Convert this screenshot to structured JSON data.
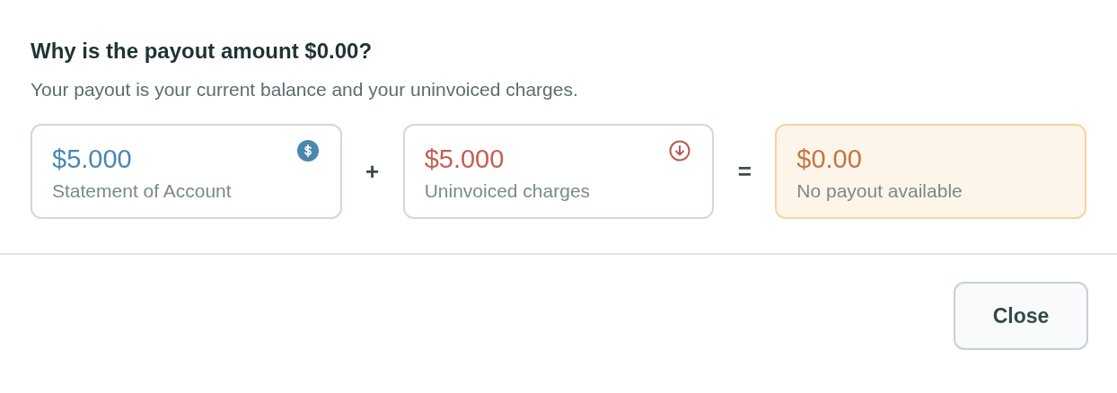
{
  "dialog": {
    "title": "Why is the payout amount $0.00?",
    "description": "Your payout is your current balance and your uninvoiced charges."
  },
  "equation": [
    {
      "kind": "balance",
      "amount": "$5.000",
      "label": "Statement of Account"
    },
    {
      "kind": "operator",
      "symbol": "+"
    },
    {
      "kind": "charges",
      "amount": "$5.000",
      "label": "Uninvoiced charges"
    },
    {
      "kind": "operator",
      "symbol": "="
    },
    {
      "kind": "result",
      "amount": "$0.00",
      "label": "No payout available"
    }
  ],
  "buttons": [
    "Close"
  ]
}
